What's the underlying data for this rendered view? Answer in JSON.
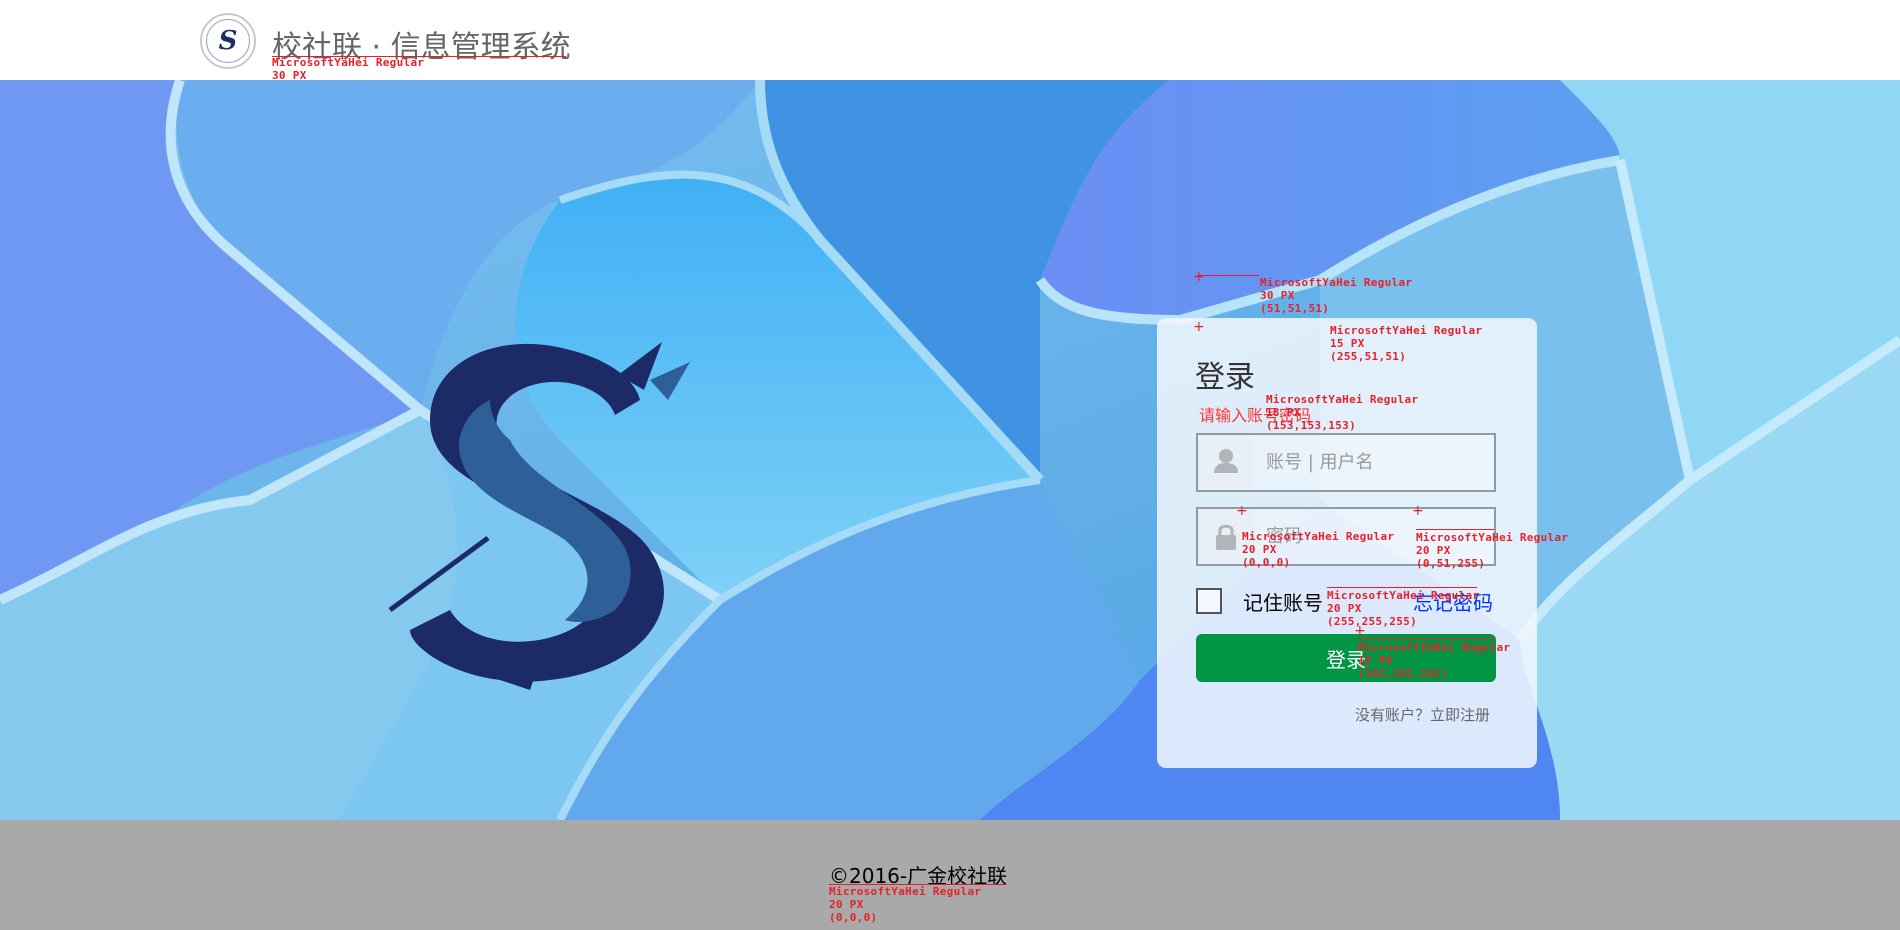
{
  "header": {
    "logo_text": "S",
    "title": "校社联 · 信息管理系统"
  },
  "login": {
    "title": "登录",
    "subtitle": "请输入账号密码",
    "username_placeholder": "账号 | 用户名",
    "password_placeholder": "密码",
    "remember_label": "记住账号",
    "forgot_label": "忘记密码",
    "submit_label": "登录",
    "register_prompt": "没有账户？",
    "register_link": "立即注册"
  },
  "footer": {
    "copyright": "©2016-广金校社联"
  },
  "annotations": {
    "header_title": "MicrosoftYaHei Regular\n30 PX\n(102,102,102)",
    "login_title": "MicrosoftYaHei Regular\n30 PX\n(51,51,51)",
    "login_subtitle": "MicrosoftYaHei Regular\n15 PX\n(255,51,51)",
    "input_placeholder": "MicrosoftYaHei Regular\n18 PX\n(153,153,153)",
    "remember": "MicrosoftYaHei Regular\n20 PX\n(0,0,0)",
    "forgot": "MicrosoftYaHei Regular\n20 PX\n(0,51,255)",
    "submit": "MicrosoftYaHei Regular\n20 PX\n(255,255,255)",
    "register": "MicrosoftYaHei Regular\n15 PX\n(102,102,102)",
    "footer": "MicrosoftYaHei Regular\n20 PX\n(0,0,0)"
  },
  "colors": {
    "submit_button": "#009544",
    "footer_bg": "#a9a9a9",
    "annotation": "#e8202a",
    "brand_navy": "#1e2c66"
  }
}
